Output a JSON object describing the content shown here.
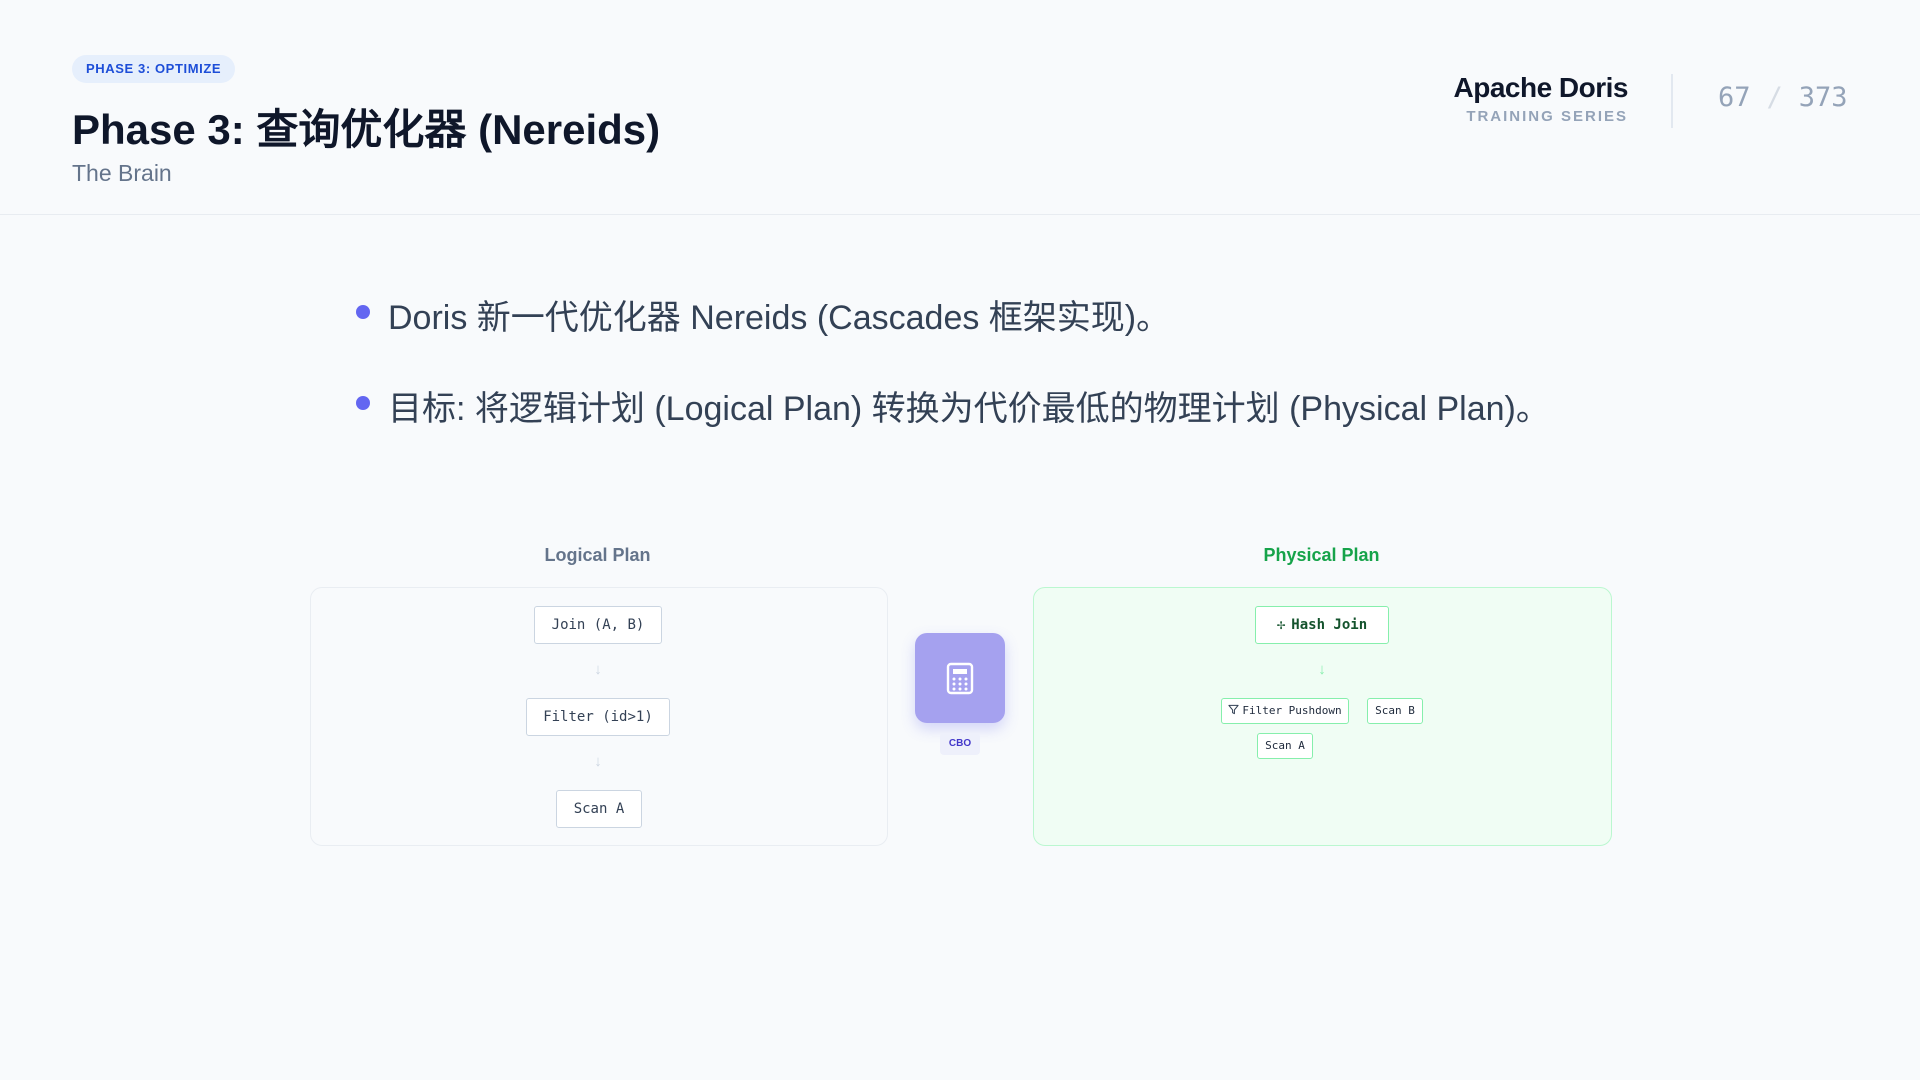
{
  "header": {
    "badge": "PHASE 3: OPTIMIZE",
    "title": "Phase 3: 查询优化器 (Nereids)",
    "subtitle": "The Brain",
    "brand_name": "Apache Doris",
    "brand_sub": "TRAINING SERIES",
    "page_current": "67",
    "page_separator": "/",
    "page_total": "373"
  },
  "bullets": [
    "Doris 新一代优化器 Nereids (Cascades 框架实现)。",
    "目标: 将逻辑计划 (Logical Plan) 转换为代价最低的物理计划 (Physical Plan)。"
  ],
  "diagram": {
    "logical": {
      "title": "Logical Plan",
      "nodes": [
        "Join (A, B)",
        "Filter (id>1)",
        "Scan A"
      ]
    },
    "optimizer": {
      "label": "CBO",
      "icon": "calculator-icon"
    },
    "physical": {
      "title": "Physical Plan",
      "join": "Hash Join",
      "filter": "Filter Pushdown",
      "scan_b": "Scan B",
      "scan_a": "Scan A"
    }
  },
  "colors": {
    "accent": "#6366f1",
    "badge_text": "#1d4ed8",
    "physical_green": "#16a34a",
    "cbo_bg": "#a5a1ef"
  }
}
